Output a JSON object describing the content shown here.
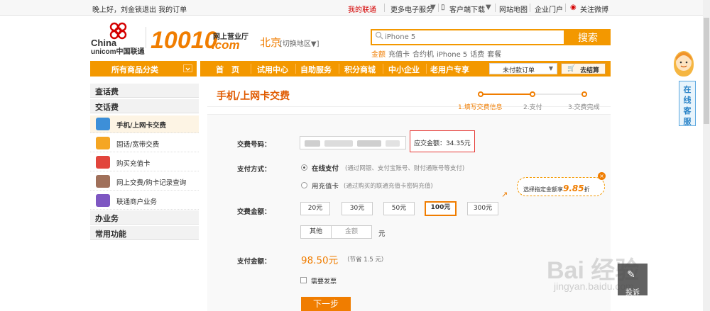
{
  "topbar": {
    "greeting": "晚上好，",
    "user": "刘金锁",
    "logout": "退出",
    "my_orders": "我的订单",
    "links": [
      "我的联通",
      "更多电子服务",
      "客户端下载",
      "网站地图",
      "企业门户",
      "关注微博"
    ]
  },
  "header": {
    "brand_en_1": "China",
    "brand_en_2": "unicom中国联通",
    "brand_num": "10010",
    "brand_dotcom": ".com",
    "brand_sub": "网上营业厅",
    "city": "北京",
    "city_switch": "[切换地区▼]",
    "search": {
      "placeholder": "iPhone 5",
      "button": "搜索"
    },
    "hot_words": [
      "金额",
      "充值卡",
      "合约机",
      "iPhone 5",
      "话费",
      "套餐"
    ]
  },
  "nav": {
    "category": "所有商品分类",
    "items": [
      "首　页",
      "试用中心",
      "自助服务",
      "积分商城",
      "中小企业",
      "老用户专享"
    ],
    "unpaid": "未付款订单",
    "cart": "去结算"
  },
  "sidebar": {
    "sections": [
      "查话费",
      "交话费",
      "办业务",
      "常用功能"
    ],
    "items": [
      "手机/上网卡交费",
      "固话/宽带交费",
      "购买充值卡",
      "网上交费/购卡记录查询",
      "联通商户业务"
    ],
    "icon_colors": [
      "#3d8fd8",
      "#f5a623",
      "#e2453c",
      "#a0705a",
      "#7e57c2"
    ]
  },
  "main": {
    "title": "手机/上网卡交费",
    "steps": [
      "1.填写交费信息",
      "2.支付",
      "3.交费完成"
    ],
    "form": {
      "phone_label": "交费号码：",
      "due_label": "应交金额：34.35元",
      "method_label": "支付方式：",
      "method_online": "在线支付",
      "method_online_note": "(通过网银、支付宝账号、财付通账号等支付)",
      "method_card": "用充值卡",
      "method_card_note": "(通过购买的联通充值卡密码充值)",
      "amount_label": "交费金额：",
      "amounts": [
        "20元",
        "30元",
        "50元",
        "100元",
        "300元"
      ],
      "selected_amount": "100元",
      "other": "其他",
      "amount_placeholder": "金额",
      "yuan": "元",
      "pay_label": "支付金额：",
      "pay_amount": "98.50元",
      "save_note": "（节省 1.5 元）",
      "invoice": "需要发票",
      "next": "下一步"
    },
    "tip": {
      "text": "选择指定金额享",
      "amount": "9.85",
      "suffix": "折"
    }
  },
  "service": {
    "label": "在线客服"
  },
  "watermark": {
    "main": "Bai 经验",
    "sub": "jingyan.baidu.com",
    "box": "投诉"
  },
  "colors": {
    "brand_orange": "#f07d00",
    "nav_orange": "#f39800",
    "alert_red": "#e53935"
  }
}
